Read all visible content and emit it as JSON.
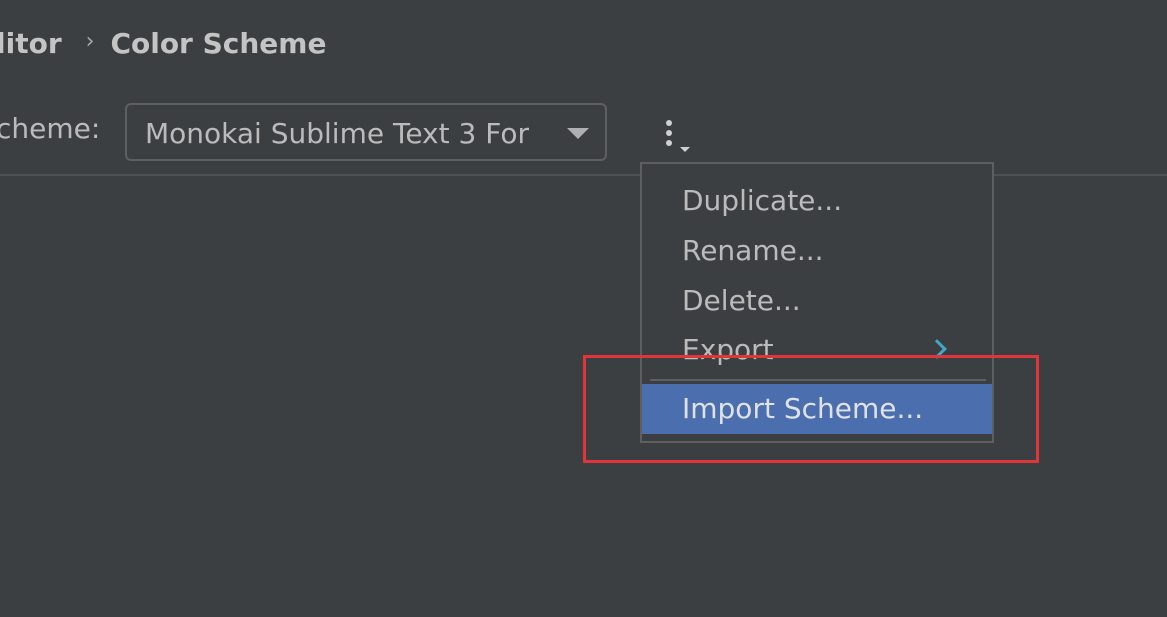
{
  "breadcrumb": {
    "parent": "litor",
    "separator": "›",
    "current": "Color Scheme"
  },
  "scheme": {
    "label": "cheme:",
    "selected_value": "Monokai Sublime Text 3 For"
  },
  "more_actions": {
    "icon": "vertical-dots-icon"
  },
  "menu": {
    "items": [
      {
        "label": "Duplicate..."
      },
      {
        "label": "Rename..."
      },
      {
        "label": "Delete..."
      },
      {
        "label": "Export",
        "has_submenu": true
      },
      {
        "label": "Import Scheme...",
        "selected": true
      }
    ]
  },
  "colors": {
    "background": "#3c3f41",
    "selection": "#4b6eaf",
    "submenu_arrow": "#3fa8c9",
    "highlight_annotation": "#e0353a"
  }
}
